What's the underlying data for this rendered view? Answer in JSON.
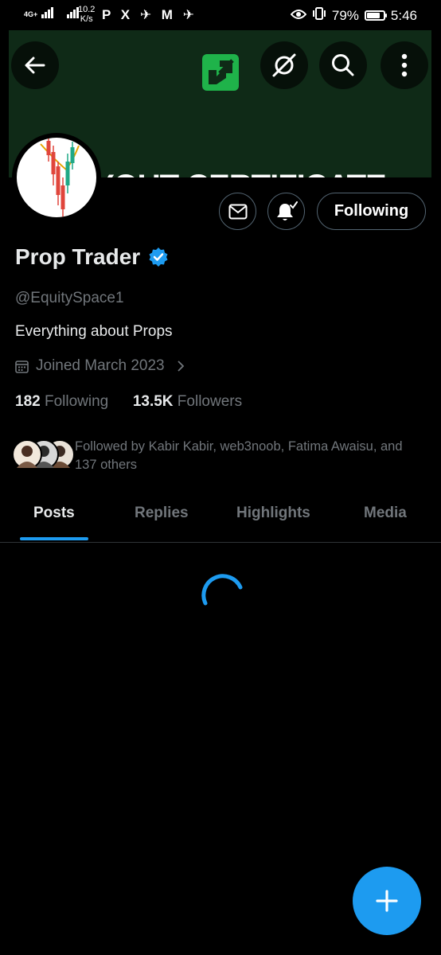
{
  "status_bar": {
    "network": "4G+",
    "speed_value": "10.2",
    "speed_unit": "K/s",
    "app_icons": "P X ✈ M ✈",
    "battery": "79%",
    "time": "5:46"
  },
  "banner": {
    "text": "YOUT CERTIFICATE",
    "bg_color": "#0f2a17",
    "logo_color": "#1fb34a"
  },
  "header_icons": [
    "back-arrow-icon",
    "grok-icon",
    "search-icon",
    "more-vertical-icon"
  ],
  "actions": {
    "message_icon": "mail-icon",
    "notify_icon": "bell-check-icon",
    "follow_label": "Following"
  },
  "profile": {
    "name": "Prop Trader",
    "verified": true,
    "handle": "@EquitySpace1",
    "bio": "Everything about Props",
    "joined": "Joined March 2023",
    "following_count": "182",
    "following_label": "Following",
    "followers_count": "13.5K",
    "followers_label": "Followers",
    "followed_by": "Followed by Kabir Kabir, web3noob, Fatima Awaisu, and 137 others"
  },
  "tabs": [
    {
      "label": "Posts",
      "active": true
    },
    {
      "label": "Replies",
      "active": false
    },
    {
      "label": "Highlights",
      "active": false
    },
    {
      "label": "Media",
      "active": false
    }
  ],
  "colors": {
    "accent": "#1d9bf0",
    "background": "#000000",
    "text_primary": "#e7e9ea",
    "text_secondary": "#71767b",
    "border": "#536471"
  },
  "fab_icon": "plus-icon"
}
